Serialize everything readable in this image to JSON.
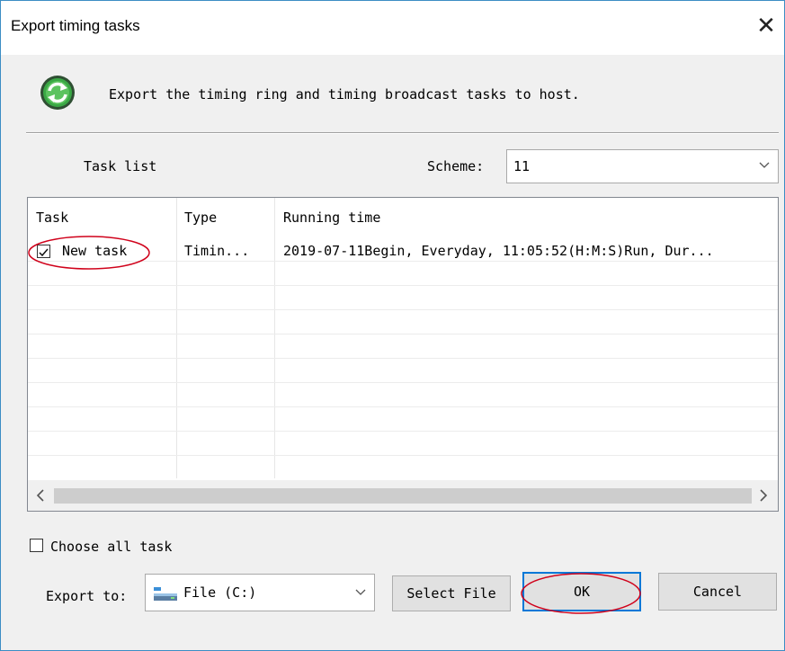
{
  "window": {
    "title": "Export timing tasks"
  },
  "header": {
    "description": "Export the timing ring and timing broadcast tasks to host."
  },
  "tasklist": {
    "label": "Task list"
  },
  "scheme": {
    "label": "Scheme:",
    "value": "11"
  },
  "table": {
    "columns": [
      "Task",
      "Type",
      "Running time"
    ],
    "rows": [
      {
        "checked": true,
        "task": "New task",
        "type": "Timin...",
        "running_time": "2019-07-11Begin, Everyday, 11:05:52(H:M:S)Run, Dur..."
      }
    ]
  },
  "choose_all": {
    "label": "Choose all task",
    "checked": false
  },
  "export": {
    "label": "Export to:",
    "value": "File (C:)"
  },
  "buttons": {
    "select_file": "Select File",
    "ok": "OK",
    "cancel": "Cancel"
  },
  "colors": {
    "accent": "#0078d7",
    "annotation": "#d0021b",
    "icon_green": "#2e9e3a"
  },
  "icons": {
    "header": "refresh-arrows-icon",
    "drive": "drive-icon"
  }
}
